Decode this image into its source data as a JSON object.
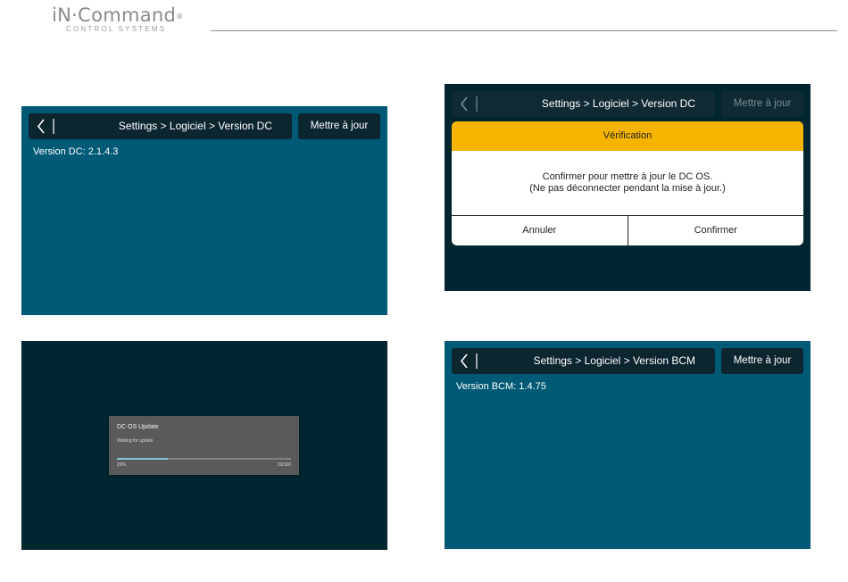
{
  "brand": {
    "name": "iN·Command",
    "registered": "®",
    "tagline": "CONTROL SYSTEMS"
  },
  "screens": {
    "dc_version": {
      "breadcrumb": "Settings > Logiciel > Version DC",
      "update_label": "Mettre à jour",
      "version_text": "Version DC: 2.1.4.3"
    },
    "verification": {
      "breadcrumb": "Settings > Logiciel > Version DC",
      "update_label": "Mettre à jour",
      "dialog_title": "Vérification",
      "message_line1": "Confirmer pour mettre à jour le DC OS.",
      "message_line2": "(Ne pas déconnecter pendant la mise à jour.)",
      "cancel_label": "Annuler",
      "confirm_label": "Confirmer"
    },
    "progress": {
      "title": "DC OS Update",
      "status": "Waiting for update",
      "percent_label": "29%",
      "count_label": "29/100",
      "progress": 0.29
    },
    "bcm_version": {
      "breadcrumb": "Settings > Logiciel > Version BCM",
      "update_label": "Mettre à jour",
      "version_text": "Version BCM: 1.4.75"
    }
  },
  "colors": {
    "teal_background": "#005a75",
    "dark_background": "#022630",
    "dialog_header": "#f5b400",
    "progress_fill": "#7fc6d6"
  },
  "icons": {
    "back": "chevron-left-icon"
  }
}
